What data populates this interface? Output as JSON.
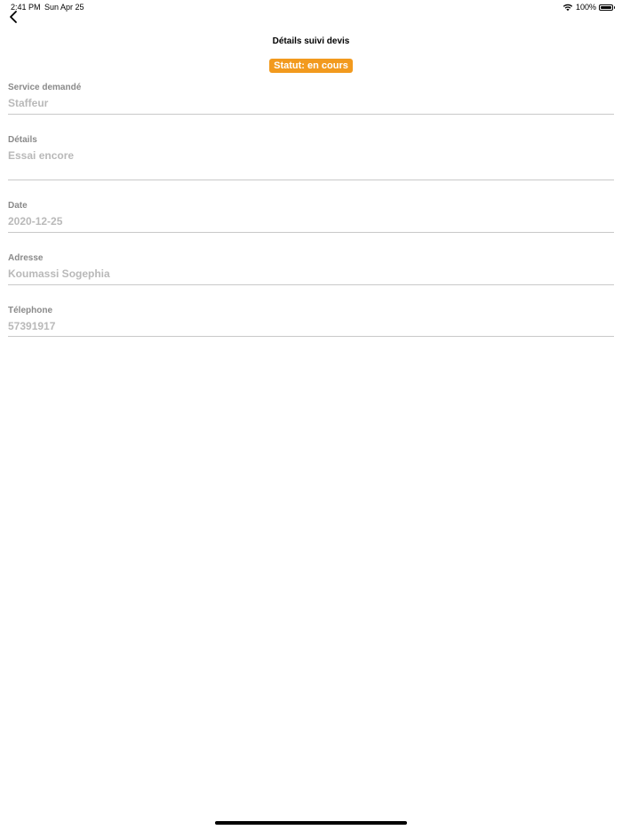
{
  "status_bar": {
    "time": "2:41 PM",
    "date": "Sun Apr 25",
    "battery": "100%"
  },
  "header": {
    "title": "Détails suivi devis"
  },
  "status_badge": {
    "text": "Statut: en cours",
    "color": "#f29a1e"
  },
  "fields": [
    {
      "label": "Service demandé",
      "value": "Staffeur"
    },
    {
      "label": "Détails",
      "value": "Essai encore"
    },
    {
      "label": "Date",
      "value": "2020-12-25"
    },
    {
      "label": "Adresse",
      "value": "Koumassi Sogephia"
    },
    {
      "label": "Télephone",
      "value": "57391917"
    }
  ]
}
